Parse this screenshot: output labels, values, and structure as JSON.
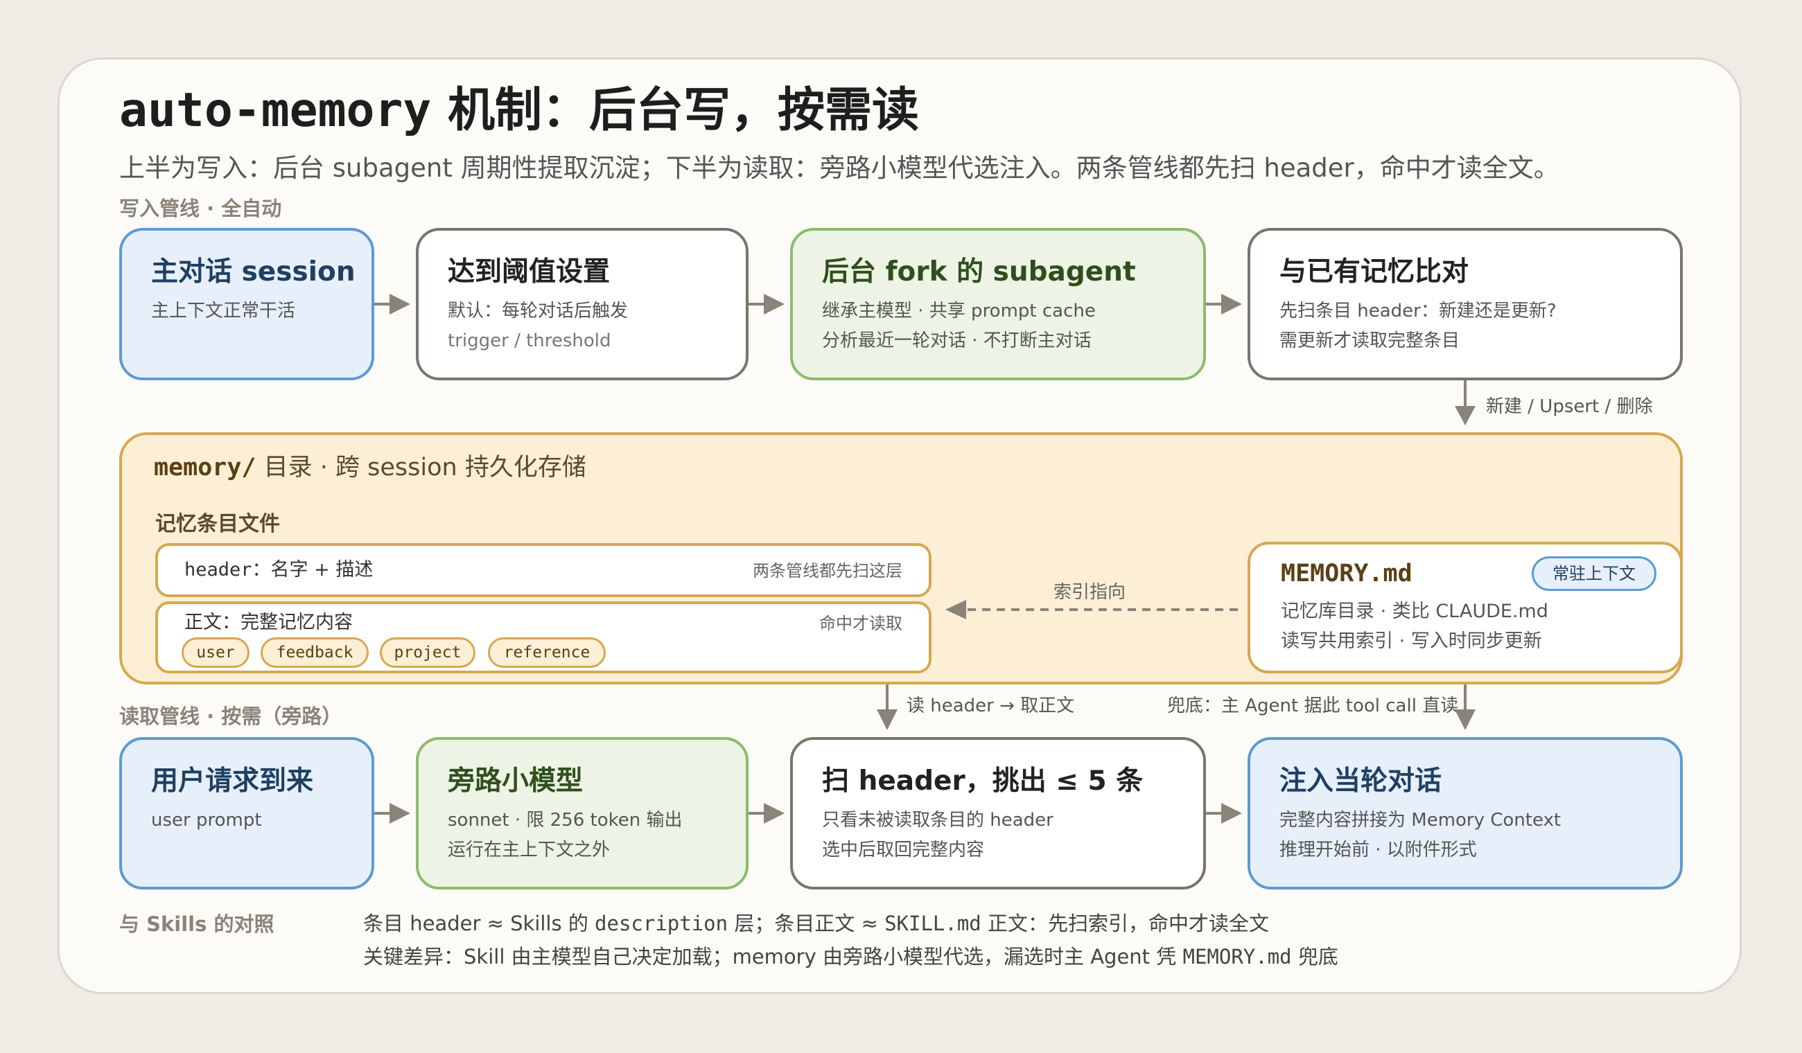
{
  "title": {
    "code": "auto-memory",
    "text": " 机制：后台写，按需读"
  },
  "subtitle": "上半为写入：后台 subagent 周期性提取沉淀；下半为读取：旁路小模型代选注入。两条管线都先扫 header，命中才读全文。",
  "write_pipeline": {
    "label": "写入管线 · 全自动",
    "steps": [
      {
        "title": "主对话 session",
        "lines": [
          "主上下文正常干活"
        ]
      },
      {
        "title": "达到阈值设置",
        "lines": [
          "默认：每轮对话后触发",
          "trigger / threshold"
        ]
      },
      {
        "title": "后台 fork 的 subagent",
        "lines": [
          "继承主模型 · 共享 prompt cache",
          "分析最近一轮对话 · 不打断主对话"
        ]
      },
      {
        "title": "与已有记忆比对",
        "lines": [
          "先扫条目 header：新建还是更新?",
          "需更新才读取完整条目"
        ]
      }
    ],
    "store_arrow_label": "新建 / Upsert / 删除"
  },
  "memory_dir": {
    "code": "memory/",
    "text": " 目录 · 跨 session 持久化存储",
    "entries_label": "记忆条目文件",
    "header_row": {
      "code": "header",
      "text": "：名字 + 描述",
      "note": "两条管线都先扫这层"
    },
    "body_row": {
      "text": "正文：完整记忆内容",
      "note": "命中才读取"
    },
    "tags": [
      "user",
      "feedback",
      "project",
      "reference"
    ],
    "index_label": "索引指向",
    "memory_md": {
      "title": "MEMORY.md",
      "badge": "常驻上下文",
      "lines": [
        "记忆库目录 · 类比 CLAUDE.md",
        "读写共用索引 · 写入时同步更新"
      ]
    }
  },
  "read_arrows": {
    "left": "读 header → 取正文",
    "right": "兜底：主 Agent 据此 tool call 直读"
  },
  "read_pipeline": {
    "label": "读取管线 · 按需（旁路）",
    "steps": [
      {
        "title": "用户请求到来",
        "lines": [
          "user prompt"
        ]
      },
      {
        "title": "旁路小模型",
        "lines": [
          "sonnet · 限 256 token 输出",
          "运行在主上下文之外"
        ]
      },
      {
        "title": "扫 header，挑出 ≤ 5 条",
        "lines": [
          "只看未被读取条目的 header",
          "选中后取回完整内容"
        ]
      },
      {
        "title": "注入当轮对话",
        "lines": [
          "完整内容拼接为 Memory Context",
          "推理开始前 · 以附件形式"
        ]
      }
    ]
  },
  "comparison": {
    "label": "与 Skills 的对照",
    "line1": {
      "a": "条目 header ≈ Skills 的 ",
      "b": "description",
      "c": " 层；条目正文 ≈ ",
      "d": "SKILL.md",
      "e": " 正文：先扫索引，命中才读全文"
    },
    "line2": {
      "a": "关键差异：Skill 由主模型自己决定加载；memory 由旁路小模型代选，漏选时主 Agent 凭 ",
      "b": "MEMORY.md",
      "c": " 兜底"
    }
  },
  "colors": {
    "blue": "#5d9bd0",
    "green": "#8cbb6a",
    "gold": "#d6a84f",
    "gray": "#7a756c",
    "arrow": "#8a8378"
  }
}
